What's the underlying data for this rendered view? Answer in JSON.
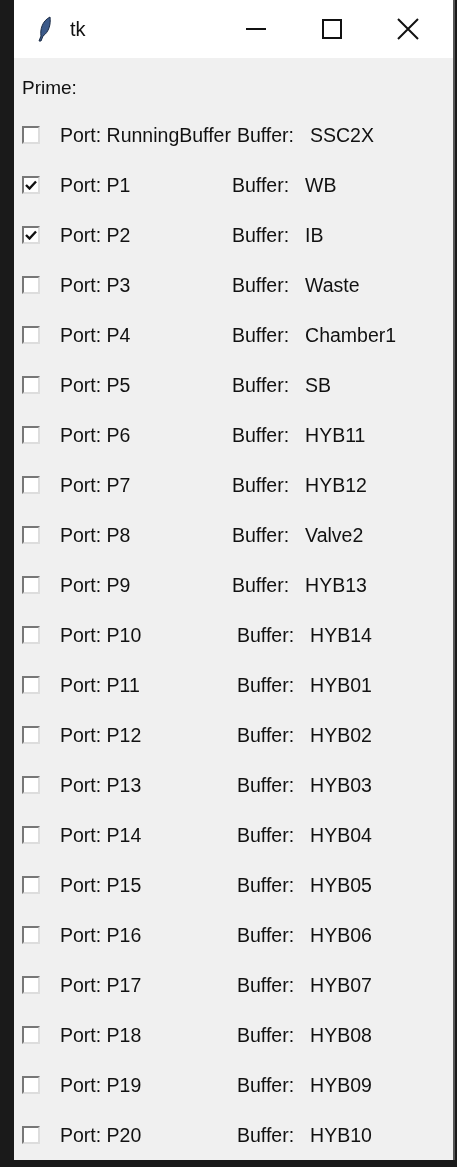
{
  "window": {
    "title": "tk"
  },
  "heading": "Prime:",
  "rows": [
    {
      "port": "Port: RunningBuffer",
      "buffer_label": "Buffer:",
      "buffer": "SSC2X",
      "checked": false
    },
    {
      "port": "Port: P1",
      "buffer_label": "Buffer:",
      "buffer": "WB",
      "checked": true
    },
    {
      "port": "Port: P2",
      "buffer_label": "Buffer:",
      "buffer": "IB",
      "checked": true
    },
    {
      "port": "Port: P3",
      "buffer_label": "Buffer:",
      "buffer": "Waste",
      "checked": false
    },
    {
      "port": "Port: P4",
      "buffer_label": "Buffer:",
      "buffer": "Chamber1",
      "checked": false
    },
    {
      "port": "Port: P5",
      "buffer_label": "Buffer:",
      "buffer": "SB",
      "checked": false
    },
    {
      "port": "Port: P6",
      "buffer_label": "Buffer:",
      "buffer": "HYB11",
      "checked": false
    },
    {
      "port": "Port: P7",
      "buffer_label": "Buffer:",
      "buffer": "HYB12",
      "checked": false
    },
    {
      "port": "Port: P8",
      "buffer_label": "Buffer:",
      "buffer": "Valve2",
      "checked": false
    },
    {
      "port": "Port: P9",
      "buffer_label": "Buffer:",
      "buffer": "HYB13",
      "checked": false
    },
    {
      "port": "Port: P10",
      "buffer_label": "Buffer:",
      "buffer": "HYB14",
      "checked": false
    },
    {
      "port": "Port: P11",
      "buffer_label": "Buffer:",
      "buffer": "HYB01",
      "checked": false
    },
    {
      "port": "Port: P12",
      "buffer_label": "Buffer:",
      "buffer": "HYB02",
      "checked": false
    },
    {
      "port": "Port: P13",
      "buffer_label": "Buffer:",
      "buffer": "HYB03",
      "checked": false
    },
    {
      "port": "Port: P14",
      "buffer_label": "Buffer:",
      "buffer": "HYB04",
      "checked": false
    },
    {
      "port": "Port: P15",
      "buffer_label": "Buffer:",
      "buffer": "HYB05",
      "checked": false
    },
    {
      "port": "Port: P16",
      "buffer_label": "Buffer:",
      "buffer": "HYB06",
      "checked": false
    },
    {
      "port": "Port: P17",
      "buffer_label": "Buffer:",
      "buffer": "HYB07",
      "checked": false
    },
    {
      "port": "Port: P18",
      "buffer_label": "Buffer:",
      "buffer": "HYB08",
      "checked": false
    },
    {
      "port": "Port: P19",
      "buffer_label": "Buffer:",
      "buffer": "HYB09",
      "checked": false
    },
    {
      "port": "Port: P20",
      "buffer_label": "Buffer:",
      "buffer": "HYB10",
      "checked": false
    }
  ]
}
